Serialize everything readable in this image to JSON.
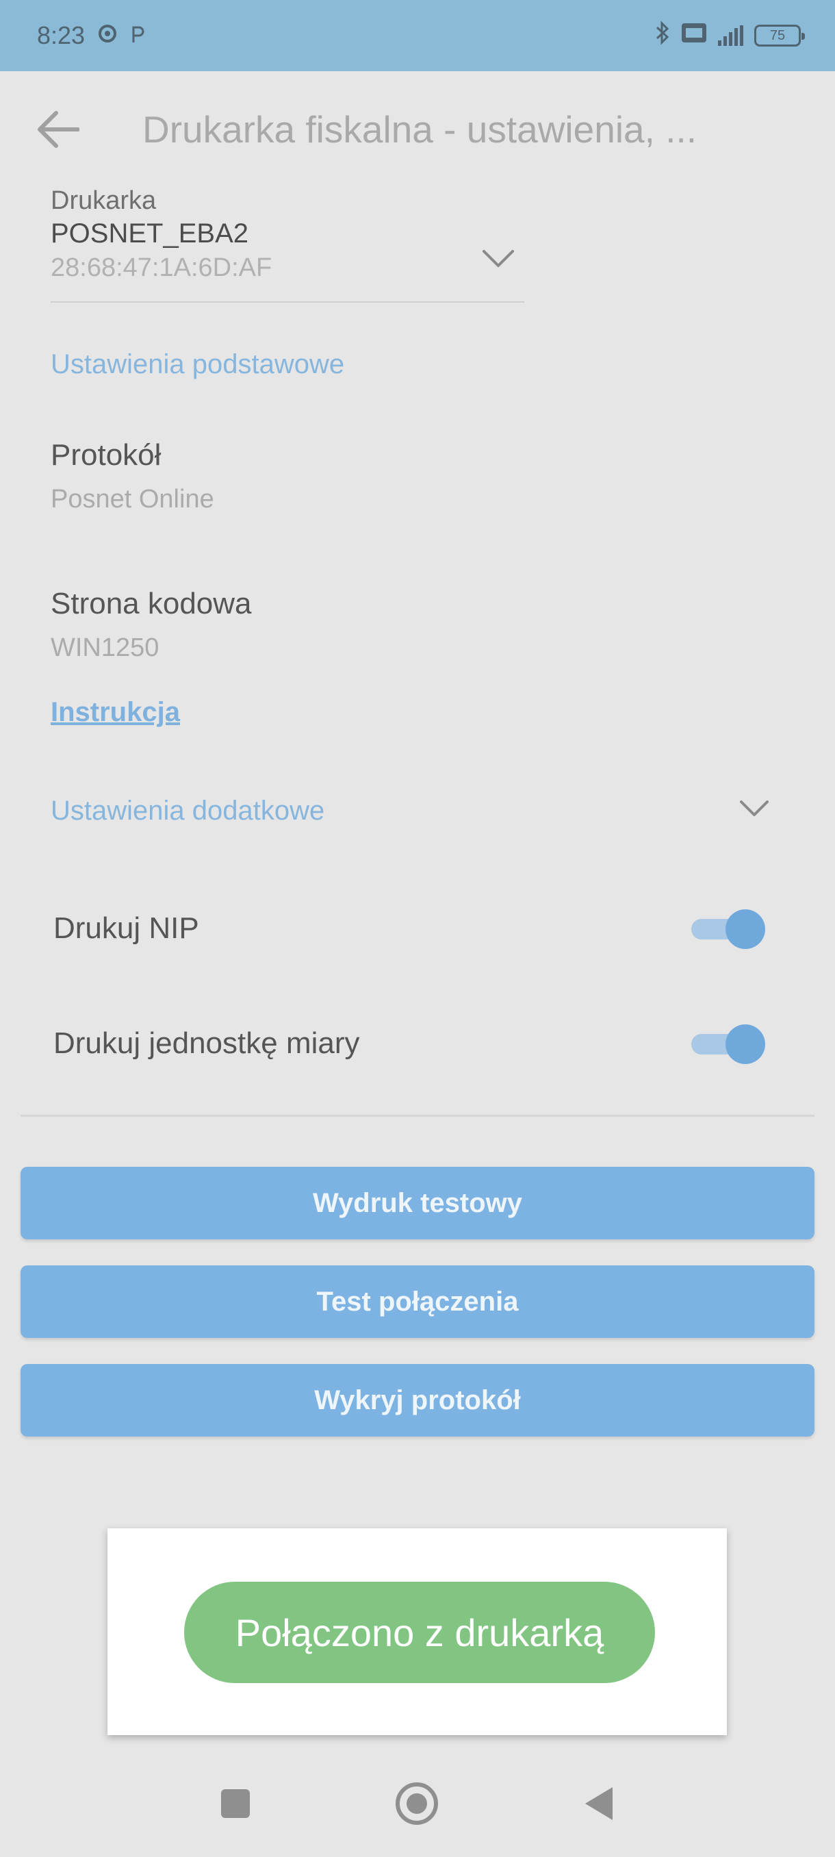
{
  "status_bar": {
    "time": "8:23",
    "battery": "75"
  },
  "app_bar": {
    "title": "Drukarka fiskalna - ustawienia, ..."
  },
  "printer": {
    "label": "Drukarka",
    "name": "POSNET_EBA2",
    "mac": "28:68:47:1A:6D:AF"
  },
  "basic_settings": {
    "header": "Ustawienia podstawowe",
    "protocol": {
      "title": "Protokół",
      "value": "Posnet Online"
    },
    "code_page": {
      "title": "Strona kodowa",
      "value": "WIN1250"
    },
    "instruction_link": "Instrukcja"
  },
  "additional_settings": {
    "header": "Ustawienia dodatkowe",
    "toggles": [
      {
        "label": "Drukuj NIP",
        "on": true
      },
      {
        "label": "Drukuj jednostkę miary",
        "on": true
      }
    ]
  },
  "buttons": {
    "test_print": "Wydruk testowy",
    "connection_test": "Test połączenia",
    "detect_protocol": "Wykryj protokół"
  },
  "toast": {
    "message": "Połączono z drukarką"
  },
  "colors": {
    "status_bar": "#8bbad6",
    "accent": "#7db3e2",
    "toast": "#82c582",
    "background": "#e6e6e6"
  }
}
